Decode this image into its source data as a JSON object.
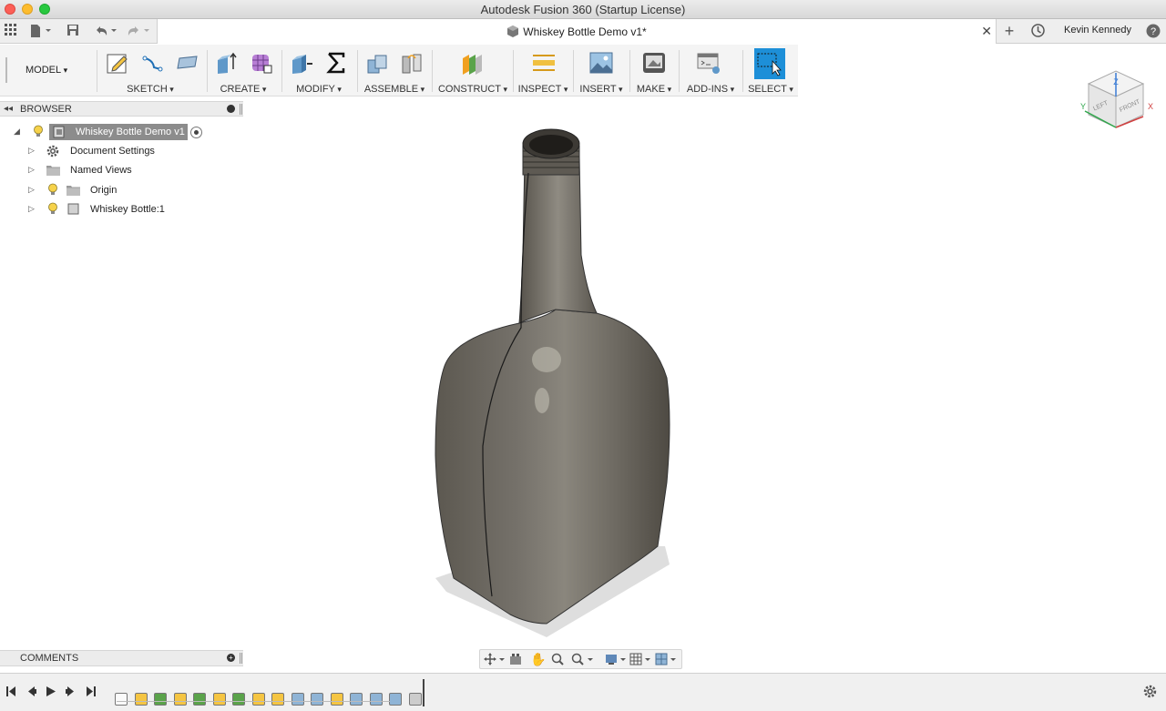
{
  "window": {
    "title": "Autodesk Fusion 360 (Startup License)"
  },
  "appbar": {
    "document_tab": "Whiskey Bottle Demo v1*",
    "user_name": "Kevin Kennedy"
  },
  "toolbar": {
    "workspace": "MODEL",
    "groups": {
      "sketch": "SKETCH",
      "create": "CREATE",
      "modify": "MODIFY",
      "assemble": "ASSEMBLE",
      "construct": "CONSTRUCT",
      "inspect": "INSPECT",
      "insert": "INSERT",
      "make": "MAKE",
      "addins": "ADD-INS",
      "select": "SELECT"
    }
  },
  "browser": {
    "title": "BROWSER",
    "root": "Whiskey Bottle Demo v1",
    "items": [
      {
        "label": "Document Settings",
        "icon": "gear-icon"
      },
      {
        "label": "Named Views",
        "icon": "folder-icon"
      },
      {
        "label": "Origin",
        "icon": "folder-icon"
      },
      {
        "label": "Whiskey Bottle:1",
        "icon": "component-icon"
      }
    ]
  },
  "comments": {
    "title": "COMMENTS"
  },
  "viewcube": {
    "top": "Z",
    "left": "LEFT",
    "front": "FRONT",
    "x_axis": "X",
    "y_axis": "Y"
  },
  "colors": {
    "accent_select": "#1d8fd8",
    "bottle": "#6b675e"
  }
}
